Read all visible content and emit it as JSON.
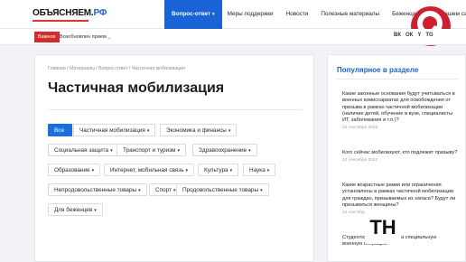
{
  "header": {
    "logo_main": "ОБЪЯСНЯЕМ.",
    "logo_suffix": "РФ",
    "nav": [
      {
        "label": "Вопрос-ответ",
        "caret": "▾",
        "active": true
      },
      {
        "label": "Меры поддержки",
        "caret": "",
        "active": false
      },
      {
        "label": "Новости",
        "caret": "",
        "active": false
      },
      {
        "label": "Полезные материалы",
        "caret": "",
        "active": false
      },
      {
        "label": "Беженцам",
        "caret": "",
        "active": false
      },
      {
        "label": "На нашем сайте",
        "caret": "",
        "active": false
      }
    ]
  },
  "newsbar": {
    "tag": "Важное",
    "text": "Возобновлен прием _"
  },
  "socials": [
    "ВК",
    "ОК",
    "Y",
    "TG"
  ],
  "colors": {
    "accent": "#1a63d6",
    "tag_red": "#d22c2c",
    "brand_badge_red": "#cf1f2e"
  },
  "main": {
    "breadcrumbs": "Главная / Материалы / Вопрос-ответ / Частичная мобилизация",
    "title": "Частичная мобилизация",
    "filters": [
      {
        "label": "Все",
        "caret": "",
        "active": true
      },
      {
        "label": "Частичная мобилизация",
        "caret": "▾",
        "active": false
      },
      {
        "label": "Экономика и финансы",
        "caret": "▾",
        "active": false
      },
      {
        "label": "Социальная защита",
        "caret": "▾",
        "active": false
      },
      {
        "label": "Транспорт и туризм",
        "caret": "▾",
        "active": false
      },
      {
        "label": "Здравоохранение",
        "caret": "▾",
        "active": false
      },
      {
        "label": "Образование",
        "caret": "▾",
        "active": false
      },
      {
        "label": "Интернет, мобильная связь",
        "caret": "▾",
        "active": false
      },
      {
        "label": "Культура",
        "caret": "▾",
        "active": false
      },
      {
        "label": "Наука",
        "caret": "▾",
        "active": false
      },
      {
        "label": "Непродовольственные товары",
        "caret": "▾",
        "active": false
      },
      {
        "label": "Спорт",
        "caret": "▾",
        "active": false
      },
      {
        "label": "Продовольственные товары",
        "caret": "▾",
        "active": false
      },
      {
        "label": "Для беженцев",
        "caret": "▾",
        "active": false
      }
    ]
  },
  "sidebar": {
    "title": "Популярное в разделе",
    "items": [
      {
        "question": "Какие законные основания будут учитываться в военных комиссариатах для освобождения от призыва в рамках частичной мобилизации (наличие детей, обучение в вузе, специалисты ИТ, заболевания и т.п.)?",
        "date": "22 сентября 2022"
      },
      {
        "question": "Кого сейчас мобилизуют, кто подлежит призыву?",
        "date": "22 сентября 2022"
      },
      {
        "question": "Какие возрастные рамки или ограничения установлены в рамках частичной мобилизации для граждан, призываемых из запаса? Будут ли призываться женщины?",
        "date": "22 сентября 2022"
      },
      {
        "question": "Студентов мобилизуют на специальную военную операцию?",
        "date": ""
      }
    ]
  },
  "badges": {
    "brand_icon": "q-badge-icon",
    "watermark_icon": "th-watermark-icon",
    "watermark_text": "TH"
  }
}
